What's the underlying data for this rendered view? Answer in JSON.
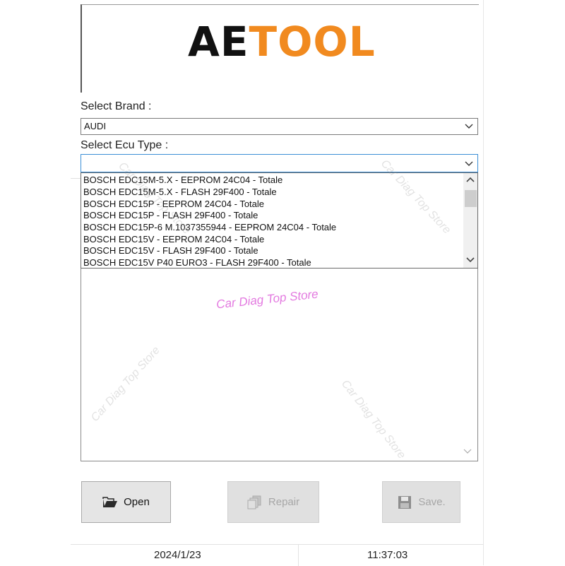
{
  "logo": {
    "part1": "AE",
    "part2": "TOOL"
  },
  "brand": {
    "label": "Select Brand    :",
    "value": "AUDI"
  },
  "ecu": {
    "label": "Select Ecu Type    :",
    "value": "",
    "options": [
      "BOSCH EDC15M-5.X - EEPROM 24C04 - Totale",
      "BOSCH EDC15M-5.X - FLASH 29F400 - Totale",
      "BOSCH EDC15P - EEPROM 24C04 - Totale",
      "BOSCH EDC15P - FLASH 29F400 - Totale",
      "BOSCH EDC15P-6 M.1037355944 - EEPROM 24C04 - Totale",
      "BOSCH EDC15V - EEPROM 24C04 - Totale",
      "BOSCH EDC15V - FLASH 29F400 - Totale",
      "BOSCH EDC15V P40 EURO3 - FLASH 29F400 - Totale"
    ]
  },
  "buttons": {
    "open": "Open",
    "repair": "Repair",
    "save": "Save."
  },
  "status": {
    "date": "2024/1/23",
    "time": "11:37:03"
  },
  "watermark": {
    "text": "Car Diag Top Store"
  },
  "colors": {
    "logo_orange": "#f18a1f",
    "watermark_pink": "#e37ae0",
    "focus_blue": "#3c8fd6"
  }
}
